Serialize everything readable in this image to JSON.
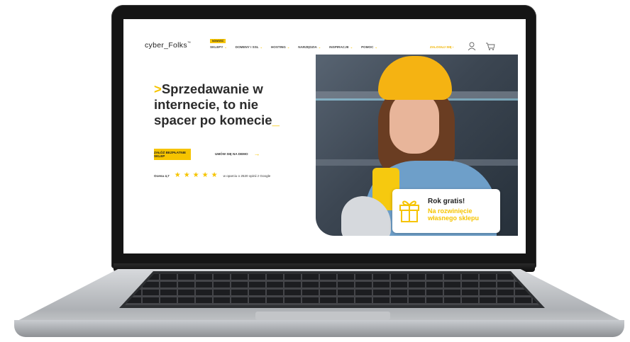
{
  "site": {
    "logo": "cyber_Folks",
    "logo_mark": "™",
    "nav": [
      {
        "label": "SKLEPY",
        "badge": "NOWOŚĆ"
      },
      {
        "label": "DOMENY I SSL"
      },
      {
        "label": "HOSTING"
      },
      {
        "label": "NARZĘDZIA"
      },
      {
        "label": "INSPIRACJE"
      },
      {
        "label": "POMOC"
      }
    ],
    "login": "ZALOGUJ SIĘ",
    "icons": [
      "user-icon",
      "cart-icon"
    ]
  },
  "hero": {
    "headline_prefix": ">",
    "headline": "Sprzedawanie w internecie, to nie spacer po komecie",
    "headline_suffix": "_",
    "cta_label": "ZAŁÓŻ BEZPŁATNIE SKLEP",
    "demo_label": "UMÓW SIĘ NA DEMO",
    "rating": {
      "label": "Ocena 4,7",
      "value": 4.7,
      "stars": 5,
      "note": "w oparciu o 2520 opinii z Google"
    }
  },
  "promo": {
    "title": "Rok gratis!",
    "subtitle": "Na rozwinięcie własnego sklepu",
    "icon": "gift-icon"
  },
  "colors": {
    "accent": "#f6c400",
    "text": "#2b2b2b"
  }
}
